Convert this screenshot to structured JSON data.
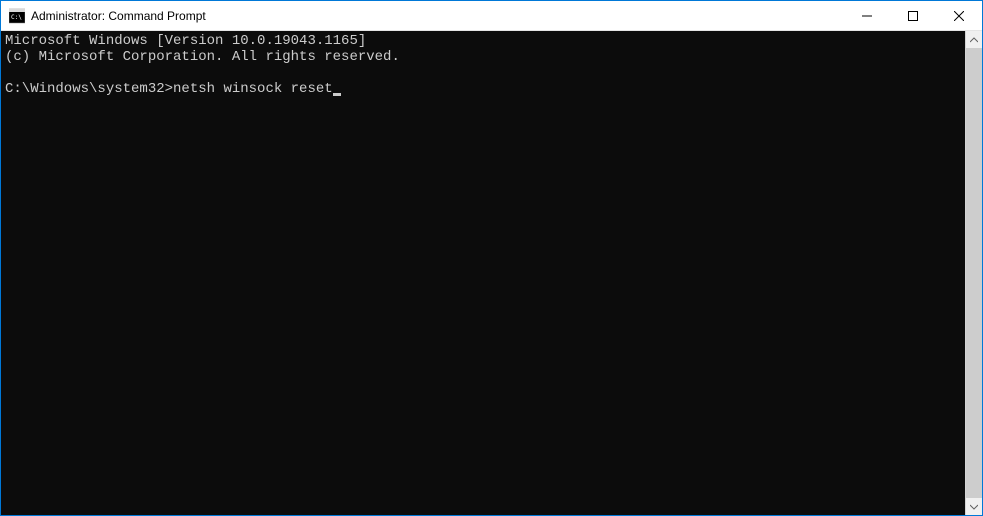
{
  "titlebar": {
    "title": "Administrator: Command Prompt"
  },
  "terminal": {
    "line1": "Microsoft Windows [Version 10.0.19043.1165]",
    "line2": "(c) Microsoft Corporation. All rights reserved.",
    "prompt": "C:\\Windows\\system32>",
    "command": "netsh winsock reset"
  }
}
